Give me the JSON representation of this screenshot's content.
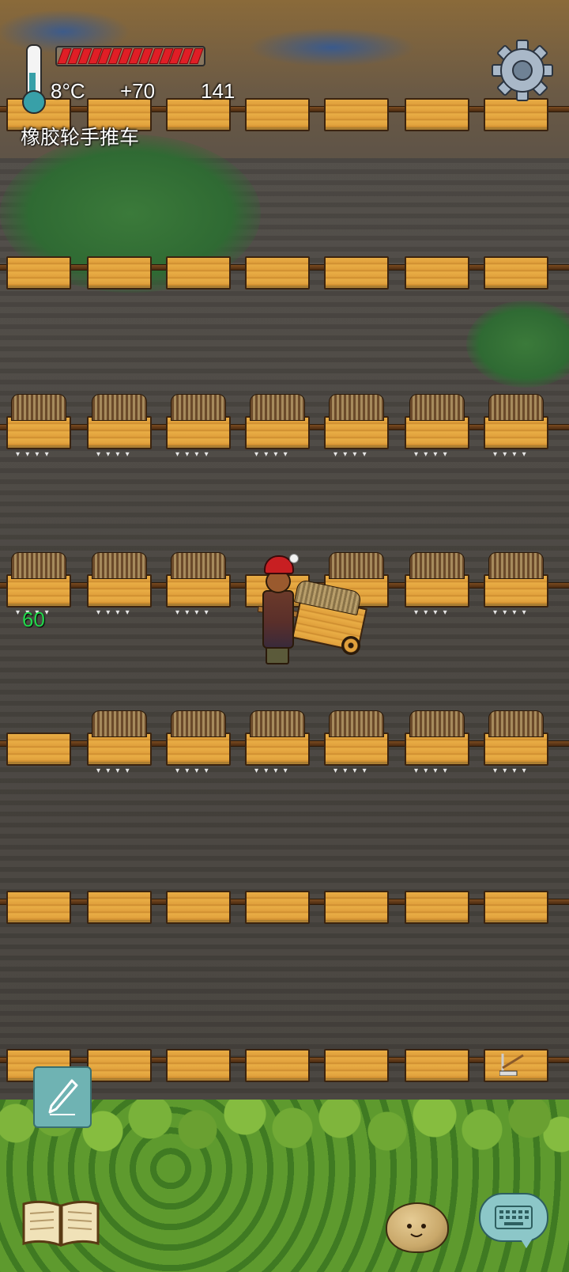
{
  "hud": {
    "temperature": "8°C",
    "yum_bonus": "+70",
    "score": "141",
    "held_item": "橡胶轮手推车",
    "hunger_fraction": 1.0,
    "hunger_pips": 14,
    "thermometer_icon": "thermometer-icon",
    "settings_icon": "gear-icon"
  },
  "world": {
    "player_age": "60"
  },
  "controls": {
    "note_icon": "pencil-icon",
    "tech_tree_icon": "open-book-icon",
    "emote_icon": "potato-face-icon",
    "chat_icon": "keyboard-icon"
  },
  "colors": {
    "hunger_red": "#e01e26",
    "age_green": "#22d64a",
    "crate_orange": "#e9ad45"
  }
}
